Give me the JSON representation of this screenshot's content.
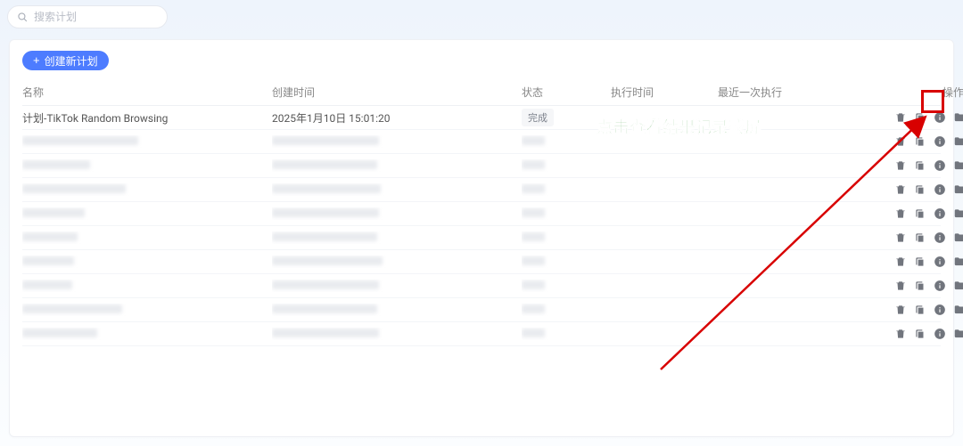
{
  "search": {
    "placeholder": "搜索计划"
  },
  "create_button": "创建新计划",
  "columns": {
    "name": "名称",
    "created": "创建时间",
    "status": "状态",
    "exec_time": "执行时间",
    "last_exec": "最近一次执行",
    "actions": "操作"
  },
  "rows": [
    {
      "name": "计划-TikTok Random Browsing",
      "created": "2025年1月10日 15:01:20",
      "status": "完成",
      "blurred": false,
      "name_w": 0,
      "created_w": 0,
      "status_w": 0
    },
    {
      "name": "",
      "created": "",
      "status": "",
      "blurred": true,
      "name_w": 130,
      "created_w": 120,
      "status_w": 26
    },
    {
      "name": "",
      "created": "",
      "status": "",
      "blurred": true,
      "name_w": 76,
      "created_w": 118,
      "status_w": 26
    },
    {
      "name": "",
      "created": "",
      "status": "",
      "blurred": true,
      "name_w": 116,
      "created_w": 122,
      "status_w": 26
    },
    {
      "name": "",
      "created": "",
      "status": "",
      "blurred": true,
      "name_w": 70,
      "created_w": 120,
      "status_w": 26
    },
    {
      "name": "",
      "created": "",
      "status": "",
      "blurred": true,
      "name_w": 62,
      "created_w": 118,
      "status_w": 26
    },
    {
      "name": "",
      "created": "",
      "status": "",
      "blurred": true,
      "name_w": 58,
      "created_w": 124,
      "status_w": 26
    },
    {
      "name": "",
      "created": "",
      "status": "",
      "blurred": true,
      "name_w": 56,
      "created_w": 120,
      "status_w": 26
    },
    {
      "name": "",
      "created": "",
      "status": "",
      "blurred": true,
      "name_w": 112,
      "created_w": 118,
      "status_w": 26
    },
    {
      "name": "",
      "created": "",
      "status": "",
      "blurred": true,
      "name_w": 84,
      "created_w": 120,
      "status_w": 26
    }
  ],
  "annotation": "点击查看结果记录截屏"
}
